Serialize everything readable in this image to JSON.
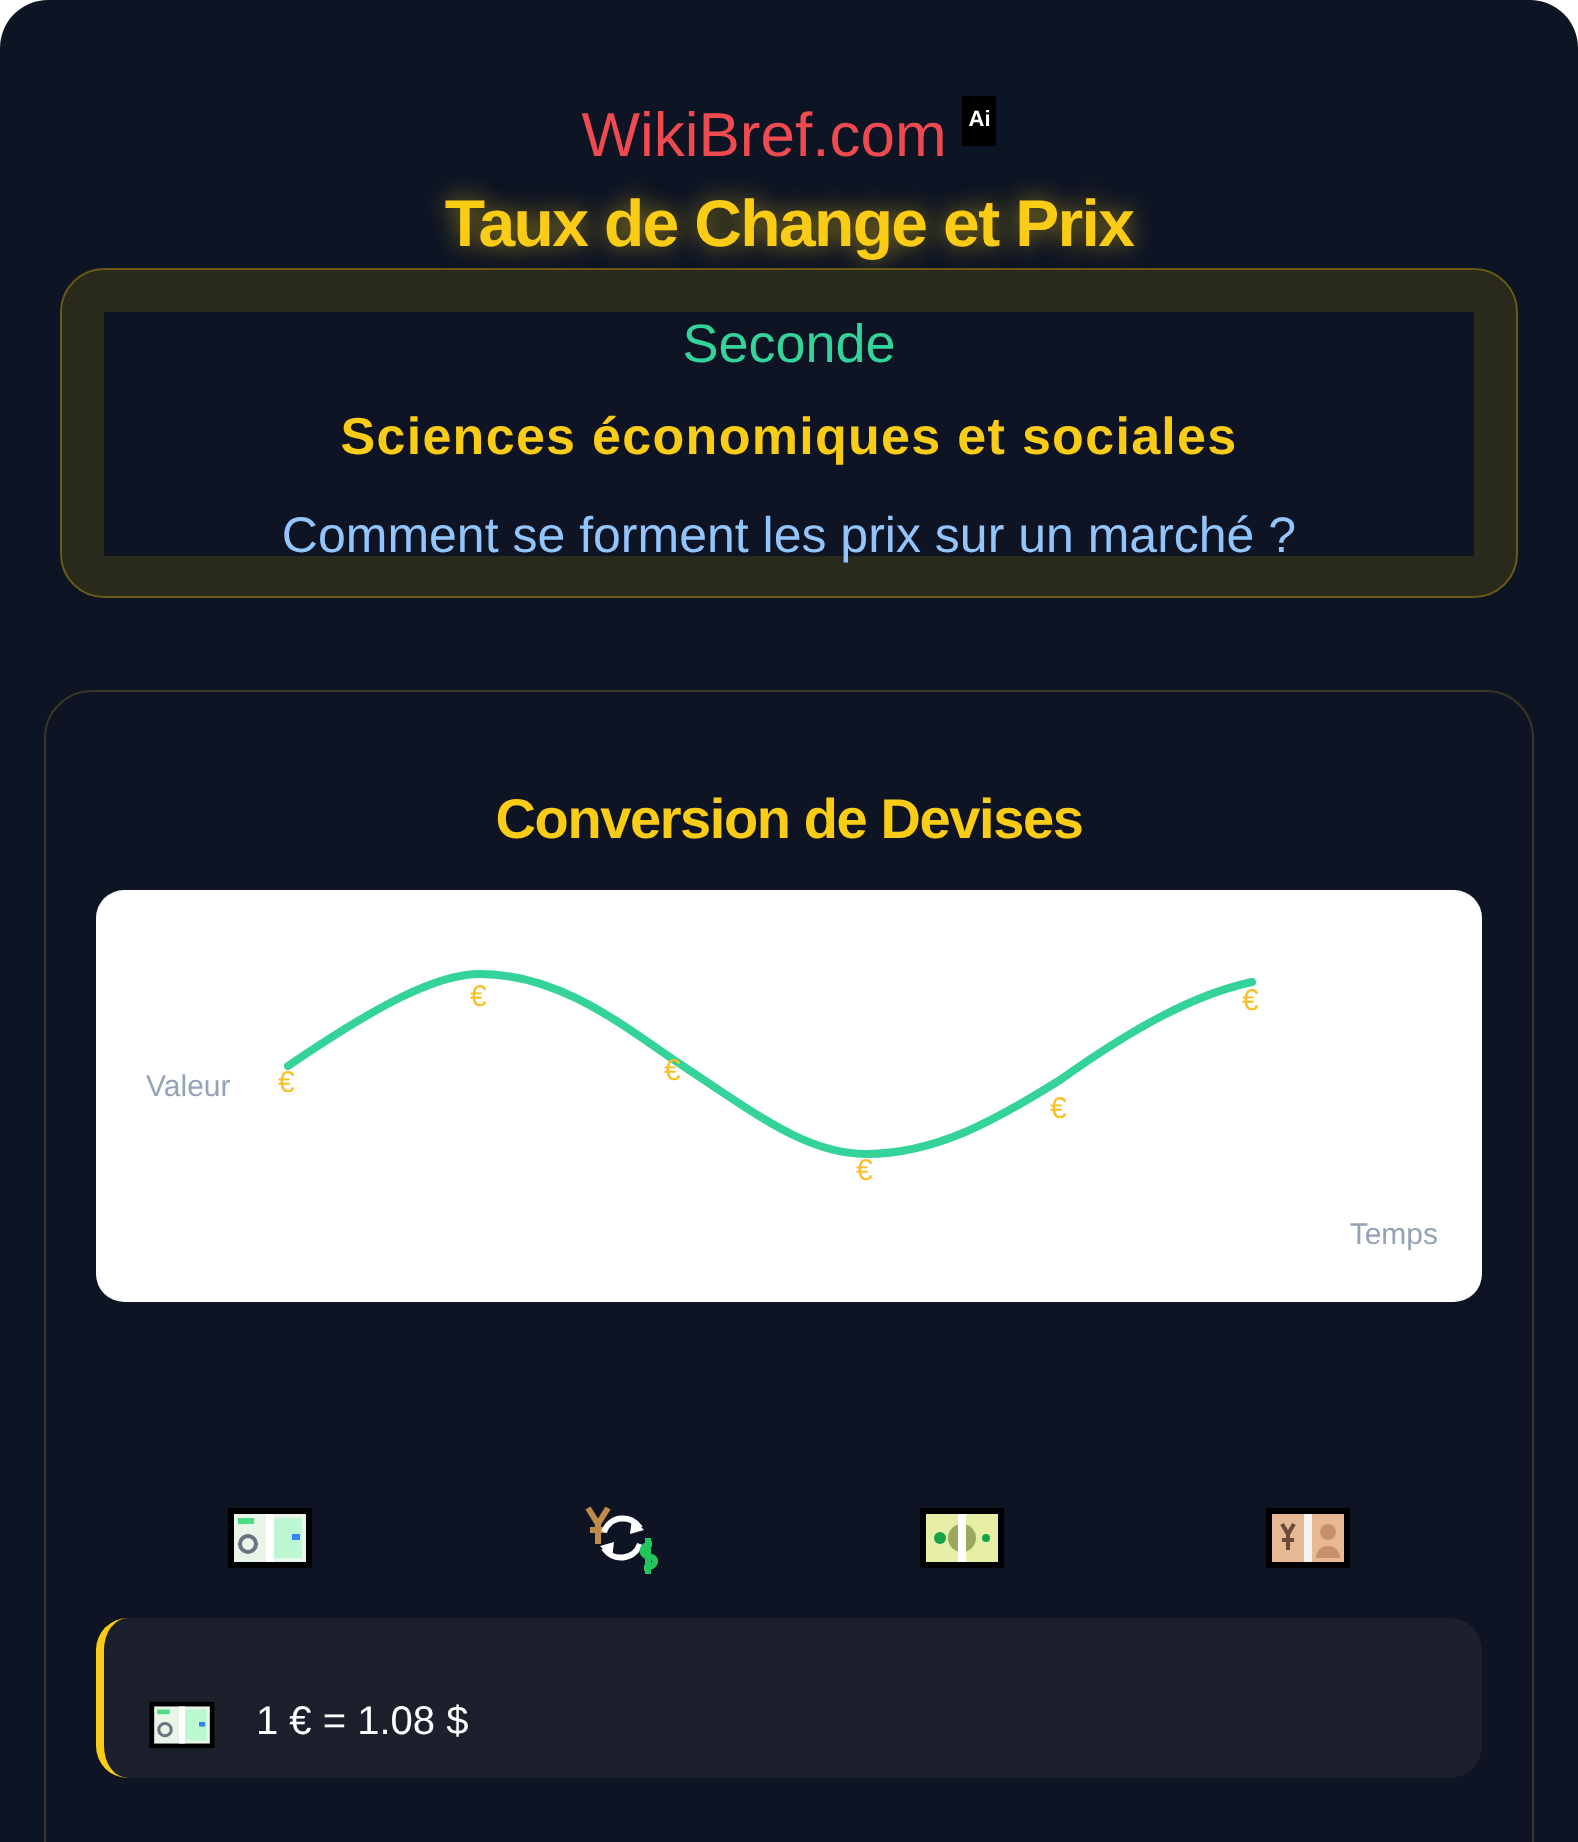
{
  "site": {
    "name": "WikiBref.com",
    "badge": "Ai"
  },
  "title": "Taux de Change et Prix",
  "header_box": {
    "level": "Seconde",
    "subject": "Sciences économiques et sociales",
    "question": "Comment se forment les prix sur un marché ?"
  },
  "card": {
    "title": "Conversion de Devises",
    "animation": {
      "y_label": "Valeur",
      "x_label": "Temps",
      "markers": [
        "€",
        "€",
        "€",
        "€",
        "€",
        "€"
      ]
    },
    "currency_icons": [
      {
        "kind": "euro"
      },
      {
        "kind": "exchange"
      },
      {
        "kind": "dollar"
      },
      {
        "kind": "yen"
      }
    ],
    "rates": [
      {
        "kind": "euro",
        "text": "1 € = 1.08 $"
      }
    ]
  }
}
